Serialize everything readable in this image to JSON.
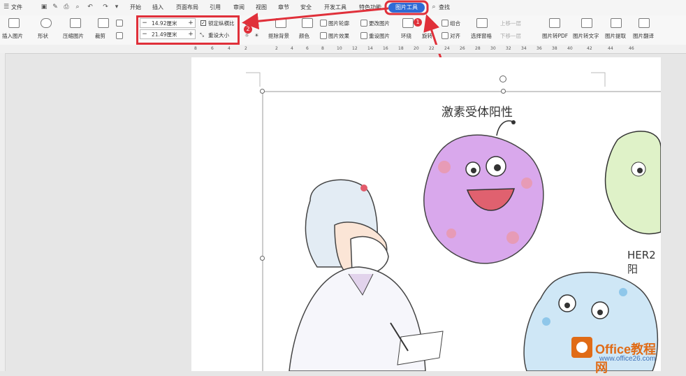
{
  "menu": {
    "file": "文件",
    "tabs": [
      "开始",
      "插入",
      "页面布局",
      "引用",
      "审阅",
      "视图",
      "章节",
      "安全",
      "开发工具",
      "特色功能"
    ],
    "active_tab": "图片工具",
    "search": "查找"
  },
  "ribbon": {
    "insert_picture": "插入图片",
    "shape": "形状",
    "compress": "压缩图片",
    "crop": "裁剪",
    "height_value": "14.92厘米",
    "width_value": "21.49厘米",
    "lock_ratio": "锁定纵横比",
    "reset_size": "重设大小",
    "remove_bg": "抠除背景",
    "color": "颜色",
    "outline": "图片轮廓",
    "effect": "图片效果",
    "change_pic": "更改图片",
    "reset_pic": "重设图片",
    "wrap": "环绕",
    "rotate": "旋转",
    "group": "组合",
    "align": "对齐",
    "selection_pane": "选择窗格",
    "bring_forward": "上移一层",
    "send_backward": "下移一层",
    "to_pdf": "图片转PDF",
    "to_text": "图片转文字",
    "extract": "图片提取",
    "translate": "图片翻译"
  },
  "annotations": {
    "badge1": "1",
    "badge2": "2",
    "accent": "#e0303a"
  },
  "ruler": [
    "8",
    "6",
    "4",
    "2",
    "2",
    "4",
    "6",
    "8",
    "10",
    "12",
    "14",
    "16",
    "18",
    "20",
    "22",
    "24",
    "26",
    "28",
    "30",
    "32",
    "34",
    "36",
    "38",
    "40",
    "42",
    "44",
    "46"
  ],
  "document": {
    "title": "激素受体阳性",
    "label2": "HER2阳",
    "watermark": "Office教程网",
    "watermark_url": "www.office26.com"
  }
}
